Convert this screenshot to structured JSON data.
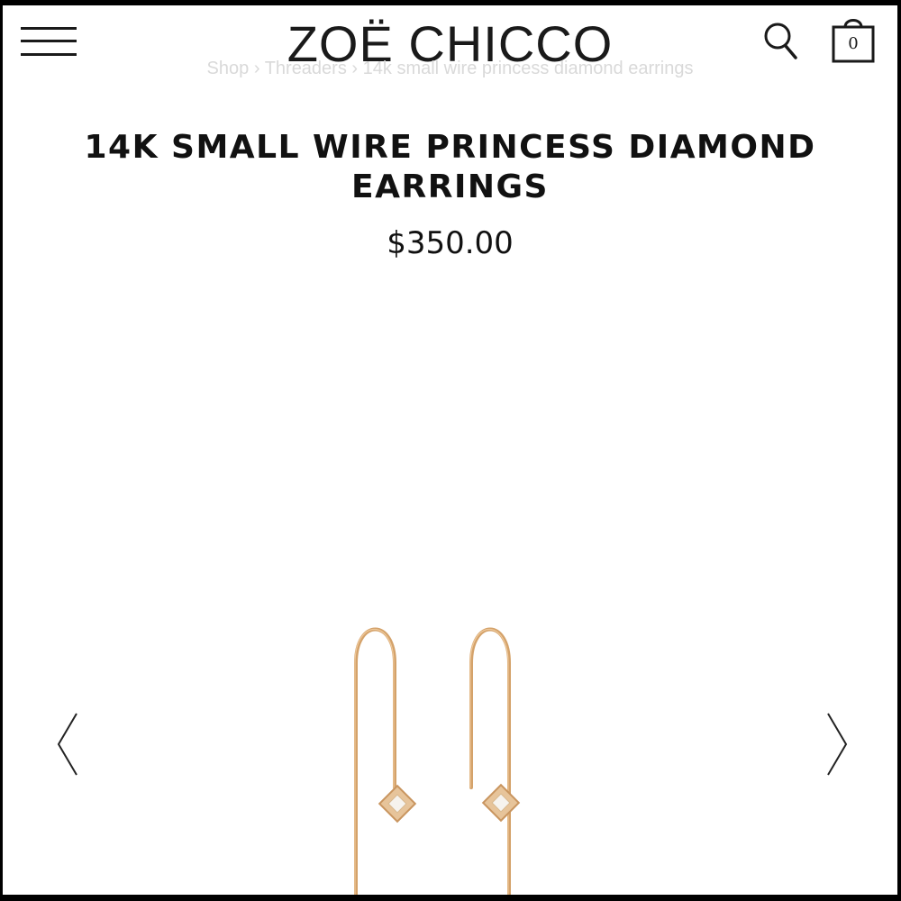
{
  "header": {
    "logo": "ZOË CHICCO",
    "cart_count": "0",
    "icons": {
      "menu": "hamburger-menu-icon",
      "search": "search-icon",
      "cart": "shopping-bag-icon"
    }
  },
  "breadcrumb": {
    "items": [
      "Shop",
      "Threaders",
      "14k small wire princess diamond earrings"
    ],
    "separator": "›"
  },
  "product": {
    "title": "14K SMALL WIRE PRINCESS DIAMOND EARRINGS",
    "price": "$350.00",
    "gallery": {
      "prev_icon": "chevron-left-icon",
      "next_icon": "chevron-right-icon"
    }
  },
  "colors": {
    "text": "#111111",
    "breadcrumb": "#d9d9d9",
    "gold": "#d4a26a"
  }
}
